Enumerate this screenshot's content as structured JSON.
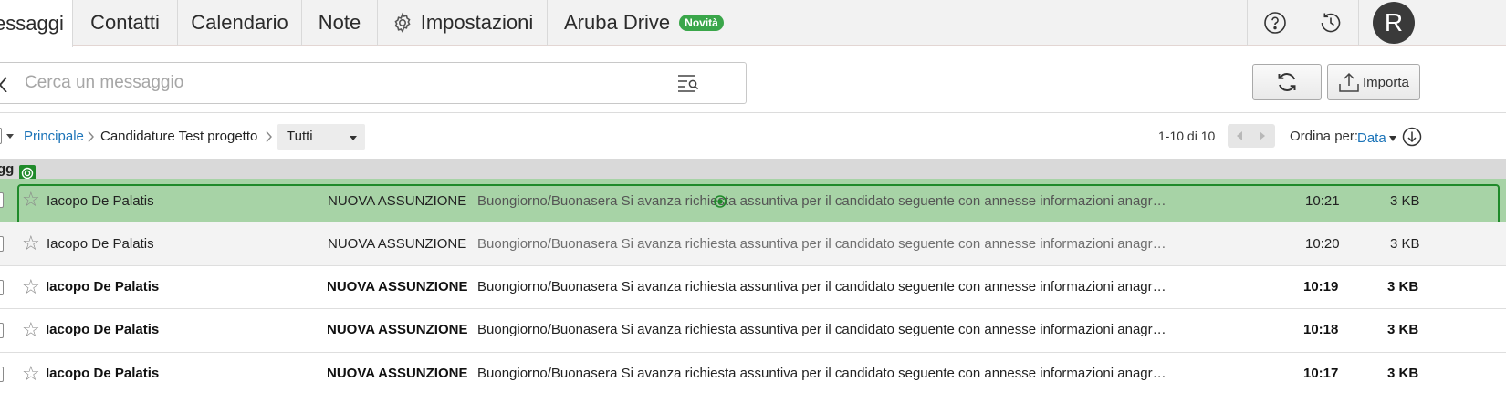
{
  "nav": {
    "tabs": [
      {
        "label": "essaggi",
        "active": true
      },
      {
        "label": "Contatti"
      },
      {
        "label": "Calendario"
      },
      {
        "label": "Note"
      },
      {
        "label": "Impostazioni",
        "icon": "gear-icon"
      },
      {
        "label": "Aruba Drive",
        "badge": "Novità"
      }
    ],
    "avatar_letter": "R",
    "icons": [
      "help-icon",
      "history-icon"
    ]
  },
  "search": {
    "placeholder": "Cerca un messaggio",
    "value": ""
  },
  "toolbar": {
    "refresh_icon": "refresh-icon",
    "import_label": "Importa"
  },
  "breadcrumb": {
    "root": "Principale",
    "folder": "Candidature Test progetto",
    "filter": "Tutti"
  },
  "pagination": {
    "range": "1-10 di 10",
    "sort_label": "Ordina per:",
    "sort_value": "Data"
  },
  "list": {
    "header_label": "gg",
    "messages": [
      {
        "sender": "Iacopo De Palatis",
        "subject": "NUOVA ASSUNZIONE",
        "preview": "Buongiorno/Buonasera Si avanza richiesta assuntiva per il candidato seguente con annesse informazioni anagr…",
        "time": "10:21",
        "size": "3 KB",
        "state": "selected"
      },
      {
        "sender": "Iacopo De Palatis",
        "subject": "NUOVA ASSUNZIONE",
        "preview": "Buongiorno/Buonasera Si avanza richiesta assuntiva per il candidato seguente con annesse informazioni anagr…",
        "time": "10:20",
        "size": "3 KB",
        "state": "read"
      },
      {
        "sender": "Iacopo De Palatis",
        "subject": "NUOVA ASSUNZIONE",
        "preview": "Buongiorno/Buonasera Si avanza richiesta assuntiva per il candidato seguente con annesse informazioni anagr…",
        "time": "10:19",
        "size": "3 KB",
        "state": "unread"
      },
      {
        "sender": "Iacopo De Palatis",
        "subject": "NUOVA ASSUNZIONE",
        "preview": "Buongiorno/Buonasera Si avanza richiesta assuntiva per il candidato seguente con annesse informazioni anagr…",
        "time": "10:18",
        "size": "3 KB",
        "state": "unread"
      },
      {
        "sender": "Iacopo De Palatis",
        "subject": "NUOVA ASSUNZIONE",
        "preview": "Buongiorno/Buonasera Si avanza richiesta assuntiva per il candidato seguente con annesse informazioni anagr…",
        "time": "10:17",
        "size": "3 KB",
        "state": "unread"
      }
    ]
  },
  "colors": {
    "accent_link": "#1a73b8",
    "badge_green": "#3aa64a",
    "selection_fill": "#a7d3a6",
    "selection_border": "#1f8a2a"
  }
}
